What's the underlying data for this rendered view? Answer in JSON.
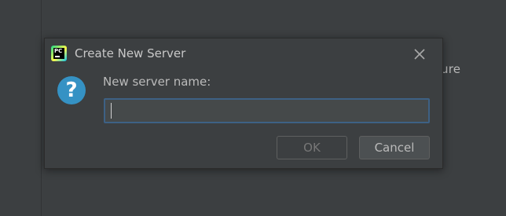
{
  "background": {
    "partial_text": "ure"
  },
  "dialog": {
    "title": "Create New Server",
    "app_icon_text": "PC",
    "prompt_label": "New server name:",
    "input_value": "",
    "input_placeholder": "",
    "ok_label": "OK",
    "cancel_label": "Cancel",
    "question_glyph": "?"
  },
  "colors": {
    "background": "#3c3f41",
    "input_border": "#3d6185",
    "question_icon": "#3592c4"
  },
  "icons": {
    "app": "pycharm-logo-icon",
    "close": "close-icon",
    "question": "question-icon"
  }
}
